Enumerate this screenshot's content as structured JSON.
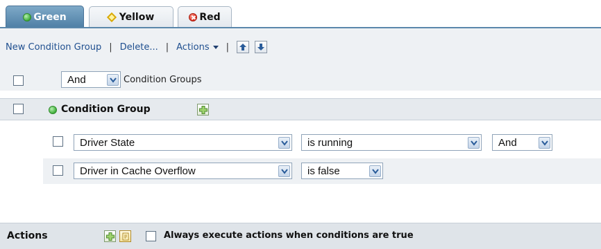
{
  "tabs": [
    {
      "label": "Green",
      "icon": "green-circle-icon",
      "active": true
    },
    {
      "label": "Yellow",
      "icon": "yellow-diamond-icon",
      "active": false
    },
    {
      "label": "Red",
      "icon": "red-x-circle-icon",
      "active": false
    }
  ],
  "toolbar": {
    "new_condition_group": "New Condition Group",
    "delete": "Delete...",
    "actions": "Actions",
    "separator": "|"
  },
  "groups_row": {
    "operator": "And",
    "label": "Condition Groups"
  },
  "condition_group": {
    "title": "Condition Group"
  },
  "conditions": [
    {
      "field": "Driver State",
      "operator": "is running",
      "conjunction": "And"
    },
    {
      "field": "Driver in Cache Overflow",
      "operator": "is false"
    }
  ],
  "actions_bar": {
    "title": "Actions",
    "always_execute_label": "Always execute actions when conditions are true"
  },
  "colors": {
    "active_tab": "#5a87ab",
    "link": "#1f4f8f",
    "toolbar_bg": "#eef1f4"
  }
}
